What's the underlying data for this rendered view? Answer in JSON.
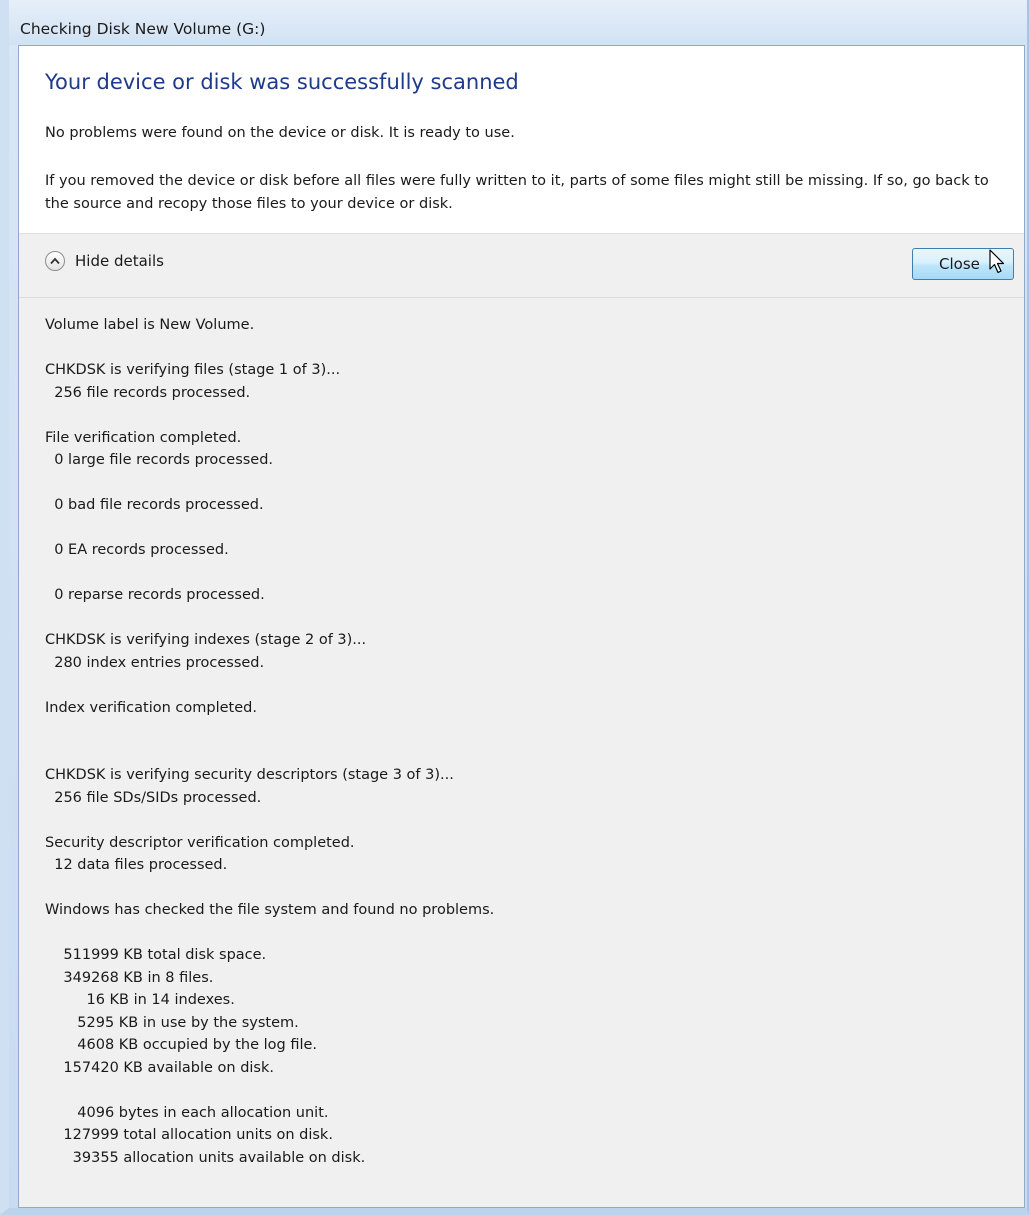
{
  "window": {
    "title": "Checking Disk New Volume (G:)"
  },
  "main": {
    "instruction": "Your device or disk was successfully scanned",
    "content_line_1": "No problems were found on the device or disk. It is ready to use.",
    "content_line_2": "If you removed the device or disk before all files were fully written to it, parts of some files might still be missing. If so, go back to the source and recopy those files to your device or disk."
  },
  "details_bar": {
    "toggle_label": "Hide details",
    "toggle_icon": "chevron-up-icon",
    "close_label": "Close"
  },
  "details": {
    "lines": [
      "Volume label is New Volume.",
      "",
      "CHKDSK is verifying files (stage 1 of 3)...",
      "  256 file records processed.",
      "",
      "File verification completed.",
      "  0 large file records processed.",
      "",
      "  0 bad file records processed.",
      "",
      "  0 EA records processed.",
      "",
      "  0 reparse records processed.",
      "",
      "CHKDSK is verifying indexes (stage 2 of 3)...",
      "  280 index entries processed.",
      "",
      "Index verification completed.",
      "",
      "",
      "CHKDSK is verifying security descriptors (stage 3 of 3)...",
      "  256 file SDs/SIDs processed.",
      "",
      "Security descriptor verification completed.",
      "  12 data files processed.",
      "",
      "Windows has checked the file system and found no problems.",
      "",
      "    511999 KB total disk space.",
      "    349268 KB in 8 files.",
      "         16 KB in 14 indexes.",
      "       5295 KB in use by the system.",
      "       4608 KB occupied by the log file.",
      "    157420 KB available on disk.",
      "",
      "       4096 bytes in each allocation unit.",
      "    127999 total allocation units on disk.",
      "      39355 allocation units available on disk."
    ]
  }
}
